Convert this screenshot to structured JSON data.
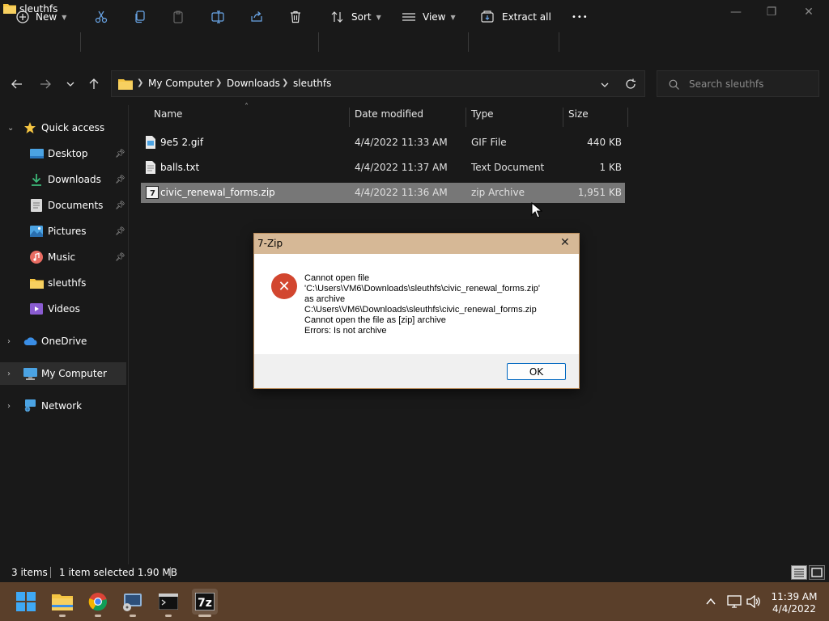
{
  "window": {
    "title": "sleuthfs",
    "controls": {
      "minimize": "—",
      "maximize": "❐",
      "close": "✕"
    }
  },
  "toolbar": {
    "new_label": "New",
    "sort_label": "Sort",
    "view_label": "View",
    "extract_label": "Extract all",
    "more_label": "•••"
  },
  "address": {
    "crumbs": [
      "My Computer",
      "Downloads",
      "sleuthfs"
    ],
    "search_placeholder": "Search sleuthfs"
  },
  "sidebar": {
    "quick_access": "Quick access",
    "items": [
      {
        "label": "Desktop",
        "pinned": true
      },
      {
        "label": "Downloads",
        "pinned": true
      },
      {
        "label": "Documents",
        "pinned": true
      },
      {
        "label": "Pictures",
        "pinned": true
      },
      {
        "label": "Music",
        "pinned": true
      },
      {
        "label": "sleuthfs",
        "pinned": false
      },
      {
        "label": "Videos",
        "pinned": false
      }
    ],
    "onedrive": "OneDrive",
    "my_computer": "My Computer",
    "network": "Network"
  },
  "file_list": {
    "columns": [
      "Name",
      "Date modified",
      "Type",
      "Size"
    ],
    "rows": [
      {
        "name": "9e5 2.gif",
        "date": "4/4/2022 11:33 AM",
        "type": "GIF File",
        "size": "440 KB"
      },
      {
        "name": "balls.txt",
        "date": "4/4/2022 11:37 AM",
        "type": "Text Document",
        "size": "1 KB"
      },
      {
        "name": "civic_renewal_forms.zip",
        "date": "4/4/2022 11:36 AM",
        "type": "zip Archive",
        "size": "1,951 KB"
      }
    ]
  },
  "dialog": {
    "title": "7-Zip",
    "close": "✕",
    "message_lines": [
      "Cannot open file",
      "'C:\\Users\\VM6\\Downloads\\sleuthfs\\civic_renewal_forms.zip'",
      "as archive",
      "C:\\Users\\VM6\\Downloads\\sleuthfs\\civic_renewal_forms.zip",
      "Cannot open the file as [zip] archive",
      "Errors: Is not archive"
    ],
    "ok_label": "OK"
  },
  "status": {
    "items_count": "3 items",
    "selection": "1 item selected  1.90 MB"
  },
  "taskbar": {
    "time": "11:39 AM",
    "date": "4/4/2022"
  },
  "colors": {
    "accent": "#0067c0",
    "selected_row": "#777777",
    "dialog_title": "#d6b896",
    "taskbar": "#5a3f2a",
    "error": "#d2462f",
    "folder": "#f5c542"
  }
}
